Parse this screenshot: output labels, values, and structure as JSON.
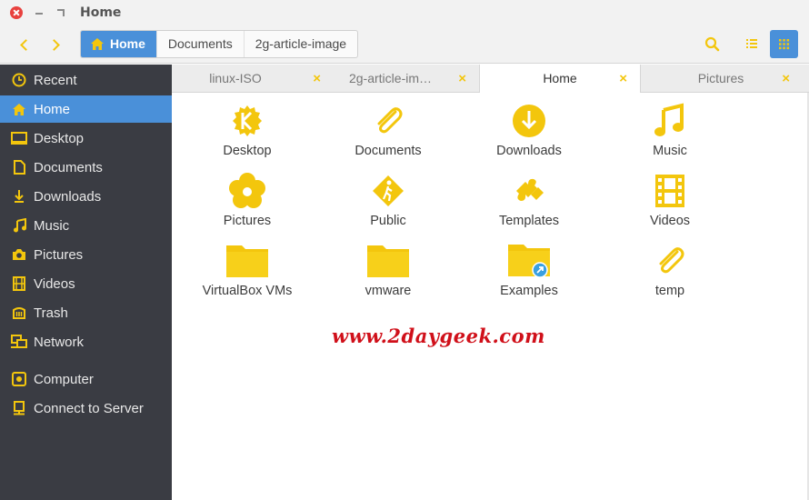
{
  "window": {
    "title": "Home"
  },
  "breadcrumb": [
    {
      "label": "Home",
      "active": true
    },
    {
      "label": "Documents",
      "active": false
    },
    {
      "label": "2g-article-image",
      "active": false
    }
  ],
  "sidebar": {
    "items": [
      {
        "label": "Recent",
        "icon": "clock-icon"
      },
      {
        "label": "Home",
        "icon": "home-icon",
        "active": true
      },
      {
        "label": "Desktop",
        "icon": "desktop-icon"
      },
      {
        "label": "Documents",
        "icon": "document-icon"
      },
      {
        "label": "Downloads",
        "icon": "download-icon"
      },
      {
        "label": "Music",
        "icon": "music-icon"
      },
      {
        "label": "Pictures",
        "icon": "camera-icon"
      },
      {
        "label": "Videos",
        "icon": "film-icon"
      },
      {
        "label": "Trash",
        "icon": "trash-icon"
      },
      {
        "label": "Network",
        "icon": "network-icon"
      },
      {
        "label": "Computer",
        "icon": "computer-icon"
      },
      {
        "label": "Connect to Server",
        "icon": "server-icon"
      }
    ]
  },
  "tabs": [
    {
      "label": "linux-ISO",
      "close": "×"
    },
    {
      "label": "2g-article-im…",
      "close": "×"
    },
    {
      "label": "Home",
      "close": "×",
      "active": true
    },
    {
      "label": "Pictures",
      "close": "×"
    }
  ],
  "files": [
    {
      "label": "Desktop",
      "icon": "kde-desktop-icon"
    },
    {
      "label": "Documents",
      "icon": "paperclip-icon"
    },
    {
      "label": "Downloads",
      "icon": "download-circle-icon"
    },
    {
      "label": "Music",
      "icon": "music-note-icon"
    },
    {
      "label": "Pictures",
      "icon": "flower-icon"
    },
    {
      "label": "Public",
      "icon": "walking-person-icon"
    },
    {
      "label": "Templates",
      "icon": "puzzle-icon"
    },
    {
      "label": "Videos",
      "icon": "film-strip-icon"
    },
    {
      "label": "VirtualBox VMs",
      "icon": "folder-icon"
    },
    {
      "label": "vmware",
      "icon": "folder-icon"
    },
    {
      "label": "Examples",
      "icon": "folder-link-icon"
    },
    {
      "label": "temp",
      "icon": "paperclip-icon"
    }
  ],
  "watermark": "www.2daygeek.com",
  "colors": {
    "accent": "#4a90d9",
    "icon_yellow": "#f3c60d",
    "sidebar_bg": "#3a3c43",
    "watermark": "#d0101a"
  }
}
